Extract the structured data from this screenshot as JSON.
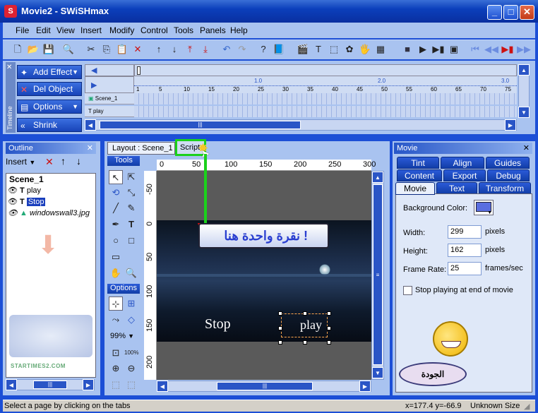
{
  "window": {
    "title": "Movie2 - SWiSHmax"
  },
  "menu": [
    "File",
    "Edit",
    "View",
    "Insert",
    "Modify",
    "Control",
    "Tools",
    "Panels",
    "Help"
  ],
  "toolbar": {
    "icons": [
      "new-icon",
      "open-icon",
      "save-icon",
      "find-icon",
      "cut-icon",
      "copy-icon",
      "paste-icon",
      "delete-icon",
      "move-up-icon",
      "move-down-icon",
      "move-top-icon",
      "move-bottom-icon",
      "undo-icon",
      "redo-icon",
      "help-icon",
      "book-icon",
      "scene-icon",
      "text-icon",
      "button-icon",
      "sprite-icon",
      "image-icon",
      "content-icon",
      "stop-icon",
      "play-icon",
      "play-frame-icon",
      "preview-icon",
      "rewind-icon",
      "back-icon",
      "forward-icon",
      "end-icon"
    ]
  },
  "timeline": {
    "side_label": "Timeline",
    "buttons": {
      "add_effect": "Add Effect",
      "del_object": "Del Object",
      "options": "Options",
      "shrink": "Shrink"
    },
    "ruler_secs": [
      "1.0",
      "2.0",
      "3.0"
    ],
    "ruler_frames": [
      "1",
      "5",
      "10",
      "15",
      "20",
      "25",
      "30",
      "35",
      "40",
      "45",
      "50",
      "55",
      "60",
      "65",
      "70",
      "75"
    ],
    "rows": [
      "Scene_1",
      "play"
    ]
  },
  "outline": {
    "title": "Outline",
    "insert_label": "Insert",
    "scene": "Scene_1",
    "items": [
      {
        "label": "play",
        "type": "T"
      },
      {
        "label": "Stop",
        "type": "T"
      },
      {
        "label": "windowswall3.jpg",
        "type": "img"
      }
    ],
    "watermark": "STARTIMES2.COM"
  },
  "stage": {
    "tabs": {
      "layout": "Layout : Scene_1",
      "script": "Script"
    },
    "tools_label": "Tools",
    "options_label": "Options",
    "zoom": "99%",
    "hruler": [
      "0",
      "50",
      "100",
      "150",
      "200",
      "250",
      "300"
    ],
    "vruler": [
      "-50",
      "0",
      "50",
      "100",
      "150",
      "200"
    ],
    "annotation": "نقرة واحدة هنا !",
    "text_stop": "Stop",
    "text_play": "play"
  },
  "movie_panel": {
    "title": "Movie",
    "tabs_row1": [
      "Tint",
      "Align",
      "Guides"
    ],
    "tabs_row2": [
      "Content",
      "Export",
      "Debug"
    ],
    "tabs_row3": [
      "Movie",
      "Text",
      "Transform"
    ],
    "bg_label": "Background Color:",
    "width_label": "Width:",
    "width_value": "299",
    "width_unit": "pixels",
    "height_label": "Height:",
    "height_value": "162",
    "height_unit": "pixels",
    "framerate_label": "Frame Rate:",
    "framerate_value": "25",
    "framerate_unit": "frames/sec",
    "stop_label": "Stop playing at end of movie",
    "mascot_caption": "الجودة",
    "bg_color": "#5a6ee0"
  },
  "status": {
    "message": "Select a page by clicking on the tabs",
    "coords": "x=177.4 y=-66.9",
    "size": "Unknown Size"
  },
  "colors": {
    "frame": "#1c4fd6",
    "panel": "#a9c3f0",
    "accent": "#2756c8",
    "annotation_arrow": "#d11",
    "highlight": "#1bd11b"
  }
}
